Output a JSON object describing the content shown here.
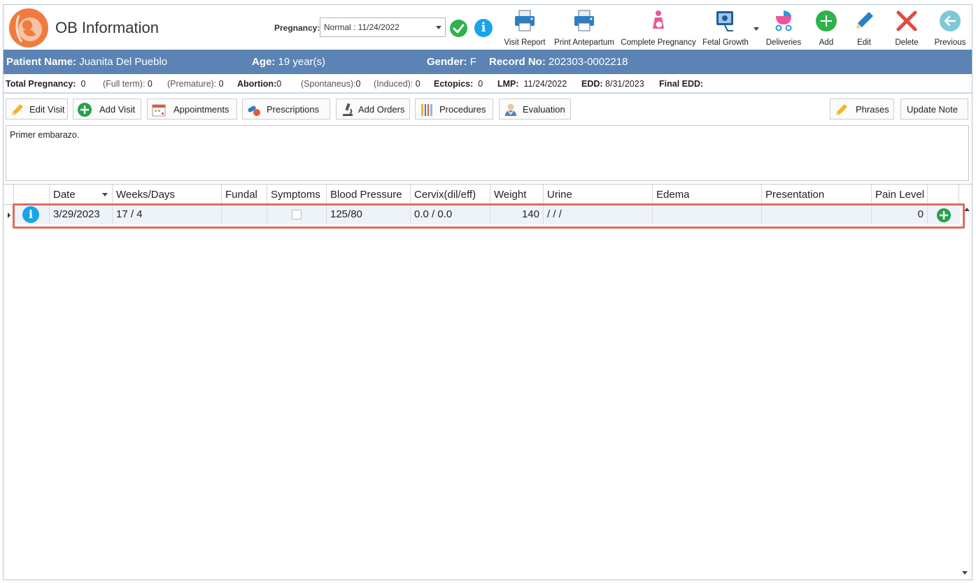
{
  "app": {
    "title": "OB Information"
  },
  "pregnancy": {
    "label": "Pregnancy:",
    "value": "Normal : 11/24/2022"
  },
  "toolbar": {
    "visit_report": "Visit Report",
    "print_antepartum": "Print Antepartum",
    "complete_pregnancy": "Complete Pregnancy",
    "fetal_growth": "Fetal Growth",
    "deliveries": "Deliveries",
    "add": "Add",
    "edit": "Edit",
    "delete": "Delete",
    "previous": "Previous"
  },
  "patient": {
    "name_label": "Patient Name:",
    "name": "Juanita Del Pueblo",
    "age_label": "Age:",
    "age": "19 year(s)",
    "gender_label": "Gender:",
    "gender": "F",
    "record_label": "Record No:",
    "record": "202303-0002218"
  },
  "summary": {
    "total_label": "Total Pregnancy:",
    "total": "0",
    "fullterm_label": "(Full term):",
    "fullterm": "0",
    "premature_label": "(Premature):",
    "premature": "0",
    "abortion_label": "Abortion:",
    "abortion": "0",
    "spontaneus_label": "(Spontaneus):",
    "spontaneus": "0",
    "induced_label": "(Induced):",
    "induced": "0",
    "ectopics_label": "Ectopics:",
    "ectopics": "0",
    "lmp_label": "LMP:",
    "lmp": "11/24/2022",
    "edd_label": "EDD:",
    "edd": "8/31/2023",
    "final_edd_label": "Final EDD:"
  },
  "actions": {
    "edit_visit": "Edit Visit",
    "add_visit": "Add Visit",
    "appointments": "Appointments",
    "prescriptions": "Prescriptions",
    "add_orders": "Add Orders",
    "procedures": "Procedures",
    "evaluation": "Evaluation",
    "phrases": "Phrases",
    "update_note": "Update Note"
  },
  "notes": {
    "text": "Primer embarazo."
  },
  "grid": {
    "columns": [
      "Date",
      "Weeks/Days",
      "Fundal",
      "Symptoms",
      "Blood Pressure",
      "Cervix(dil/eff)",
      "Weight",
      "Urine",
      "Edema",
      "Presentation",
      "Pain Level"
    ],
    "rows": [
      {
        "date": "3/29/2023",
        "weeks_days": "17 / 4",
        "fundal": "",
        "symptoms": false,
        "blood_pressure": "125/80",
        "cervix": "0.0 / 0.0",
        "weight": "140",
        "urine": "/ / /",
        "edema": "",
        "presentation": "",
        "pain_level": "0"
      }
    ]
  },
  "colors": {
    "patient_bar": "#5b84b5",
    "accent_blue": "#1aa3e8",
    "accent_green": "#2fb24a",
    "highlight": "#e06a5f"
  }
}
